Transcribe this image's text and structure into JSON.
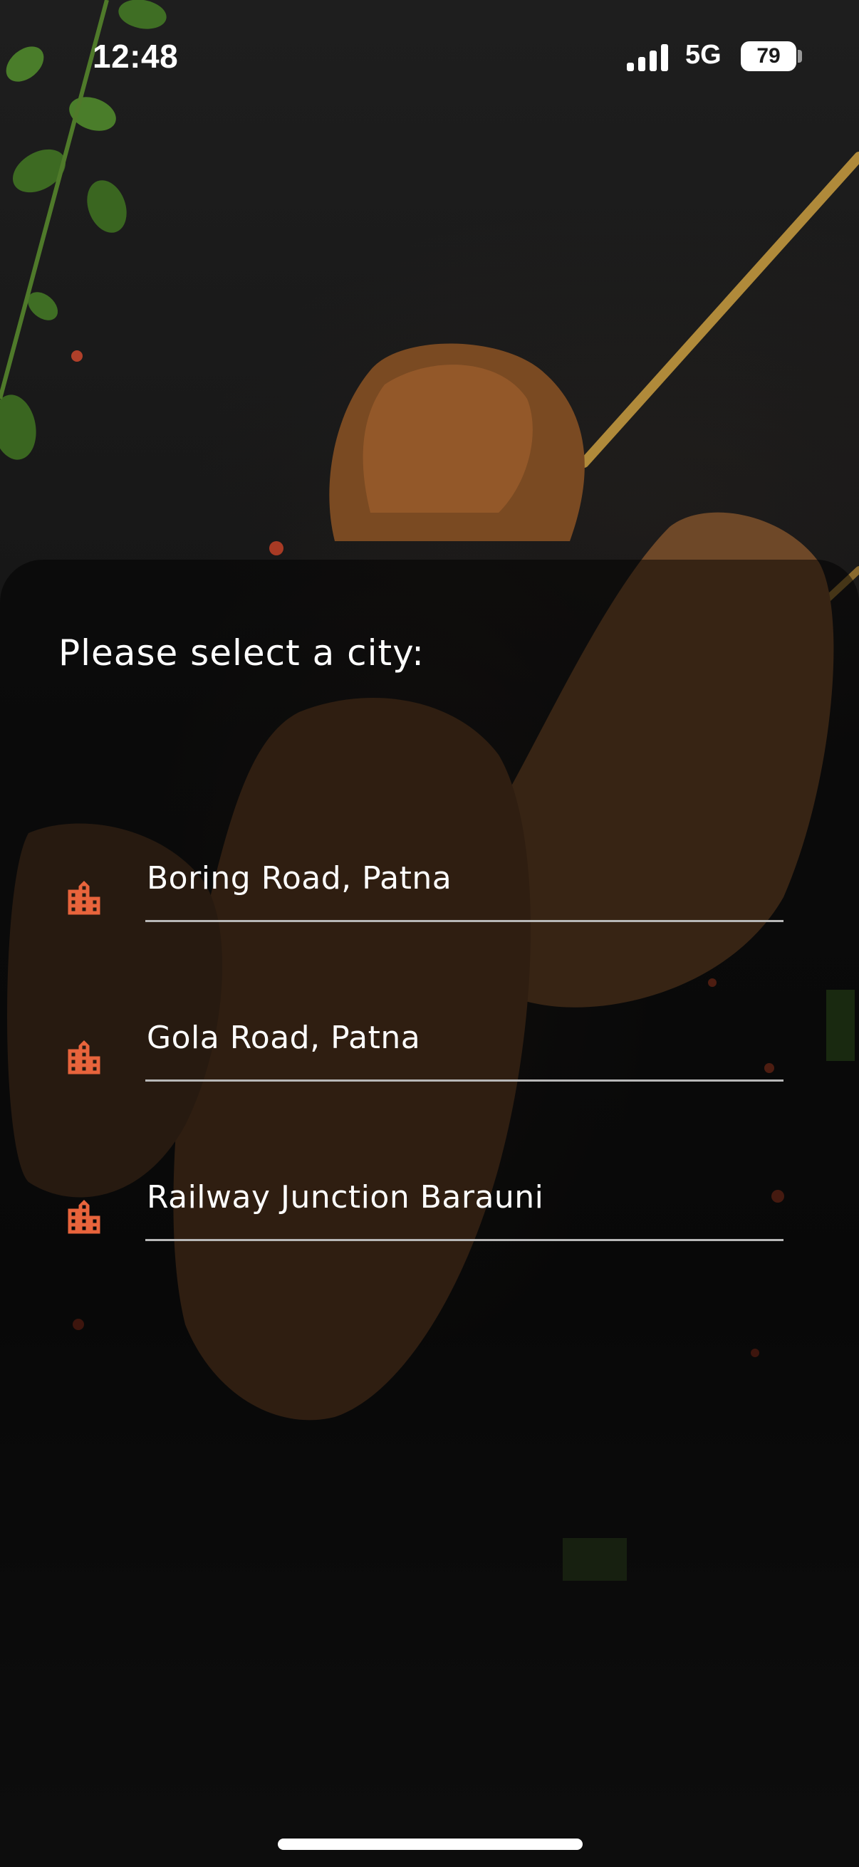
{
  "status_bar": {
    "time": "12:48",
    "network": "5G",
    "battery": "79"
  },
  "city_picker": {
    "title": "Please select a city:",
    "accent_color": "#e8643c",
    "cities": [
      {
        "label": "Boring Road, Patna",
        "icon": "city-buildings-icon"
      },
      {
        "label": "Gola Road, Patna",
        "icon": "city-buildings-icon"
      },
      {
        "label": "Railway Junction Barauni",
        "icon": "city-buildings-icon"
      }
    ]
  }
}
